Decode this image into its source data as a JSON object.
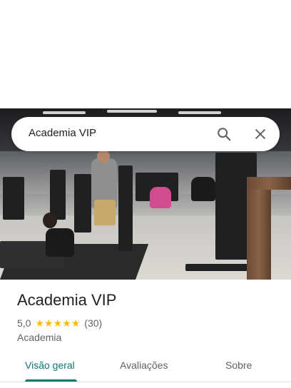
{
  "search": {
    "query": "Academia VIP",
    "search_icon": "search-icon",
    "close_icon": "close-icon"
  },
  "photo": {
    "description_icon": "place-photo"
  },
  "place": {
    "name": "Academia VIP",
    "rating": "5,0",
    "stars_count": 5,
    "reviews": "(30)",
    "category": "Academia"
  },
  "tabs": [
    {
      "label": "Visão geral",
      "active": true
    },
    {
      "label": "Avaliações",
      "active": false
    },
    {
      "label": "Sobre",
      "active": false
    }
  ],
  "colors": {
    "accent": "#0b7a6e",
    "star": "#fbbc04",
    "text_primary": "#202124",
    "text_secondary": "#5f6368"
  }
}
